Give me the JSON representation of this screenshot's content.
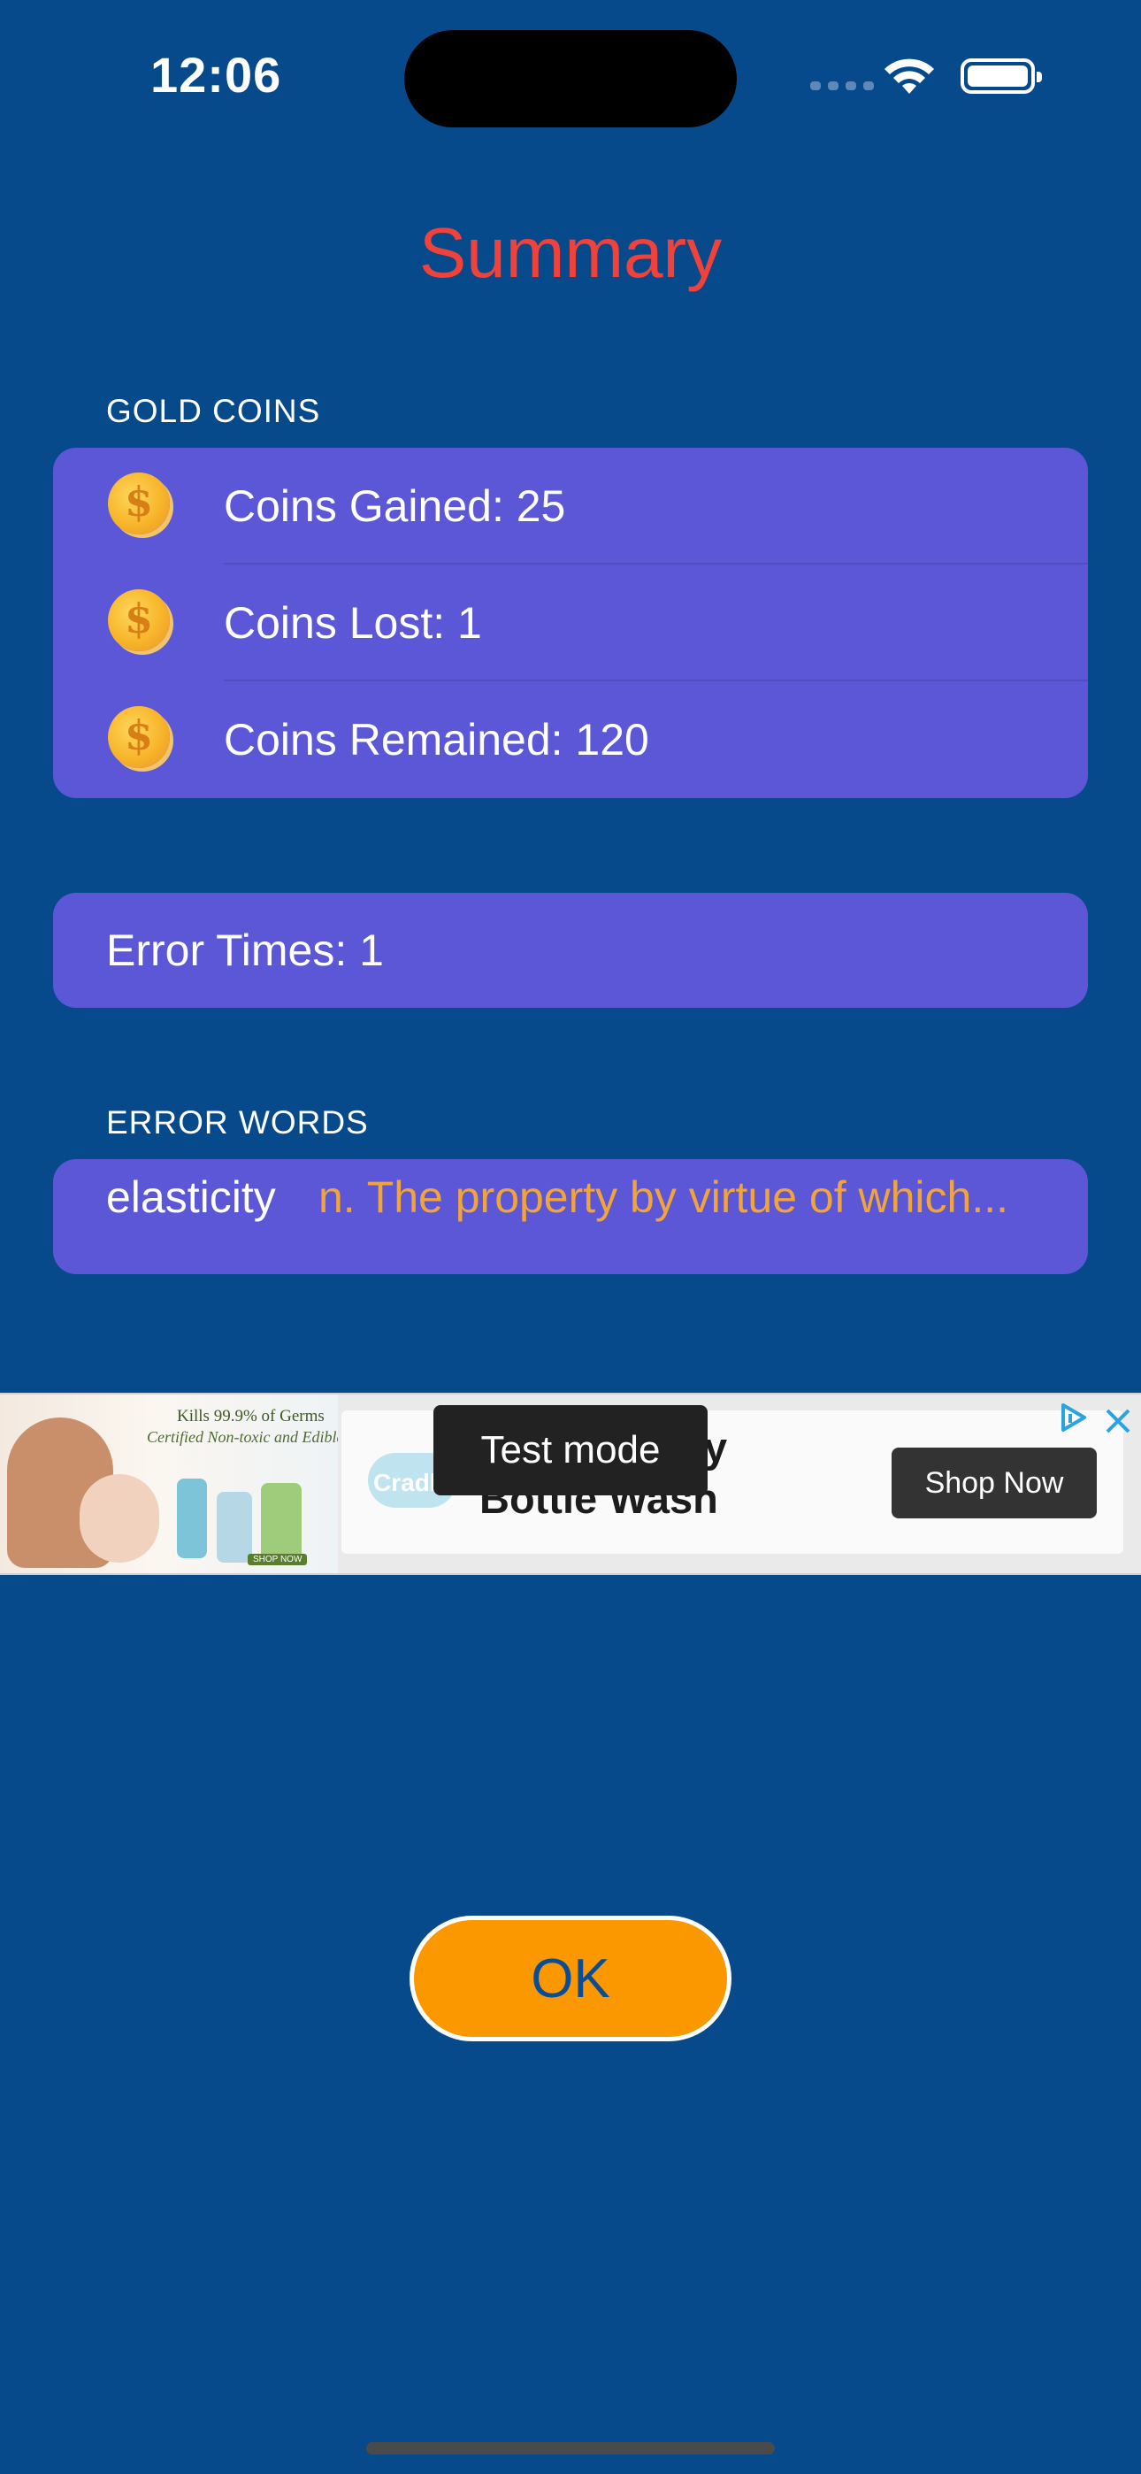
{
  "status_bar": {
    "time": "12:06",
    "wifi_icon": "wifi-icon",
    "battery_icon": "battery-icon"
  },
  "screen": {
    "title": "Summary"
  },
  "gold_coins": {
    "label": "GOLD COINS",
    "icon": "coin-icon",
    "rows": [
      {
        "text": "Coins Gained: 25"
      },
      {
        "text": "Coins Lost: 1"
      },
      {
        "text": "Coins Remained: 120"
      }
    ]
  },
  "errors": {
    "times_text": "Error Times: 1"
  },
  "error_words": {
    "label": "ERROR WORDS",
    "items": [
      {
        "word": "elasticity",
        "definition": "n. The property by virtue of which..."
      }
    ]
  },
  "ad": {
    "image_tagline": "Kills 99.9% of Germs",
    "image_subtagline": "Certified Non-toxic and Edible",
    "image_shop": "SHOP NOW",
    "logo_text": "Cradl",
    "headline_top": "y",
    "headline": "Bottle Wash",
    "cta": "Shop Now",
    "test_mode": "Test mode",
    "adchoices_icon": "adchoices-icon",
    "close_icon": "close-icon"
  },
  "ok_button": {
    "label": "OK"
  },
  "colors": {
    "background": "#064a8b",
    "card": "#5b57d6",
    "title": "#f0413b",
    "definition": "#f2a33a",
    "ok": "#fb9800"
  }
}
